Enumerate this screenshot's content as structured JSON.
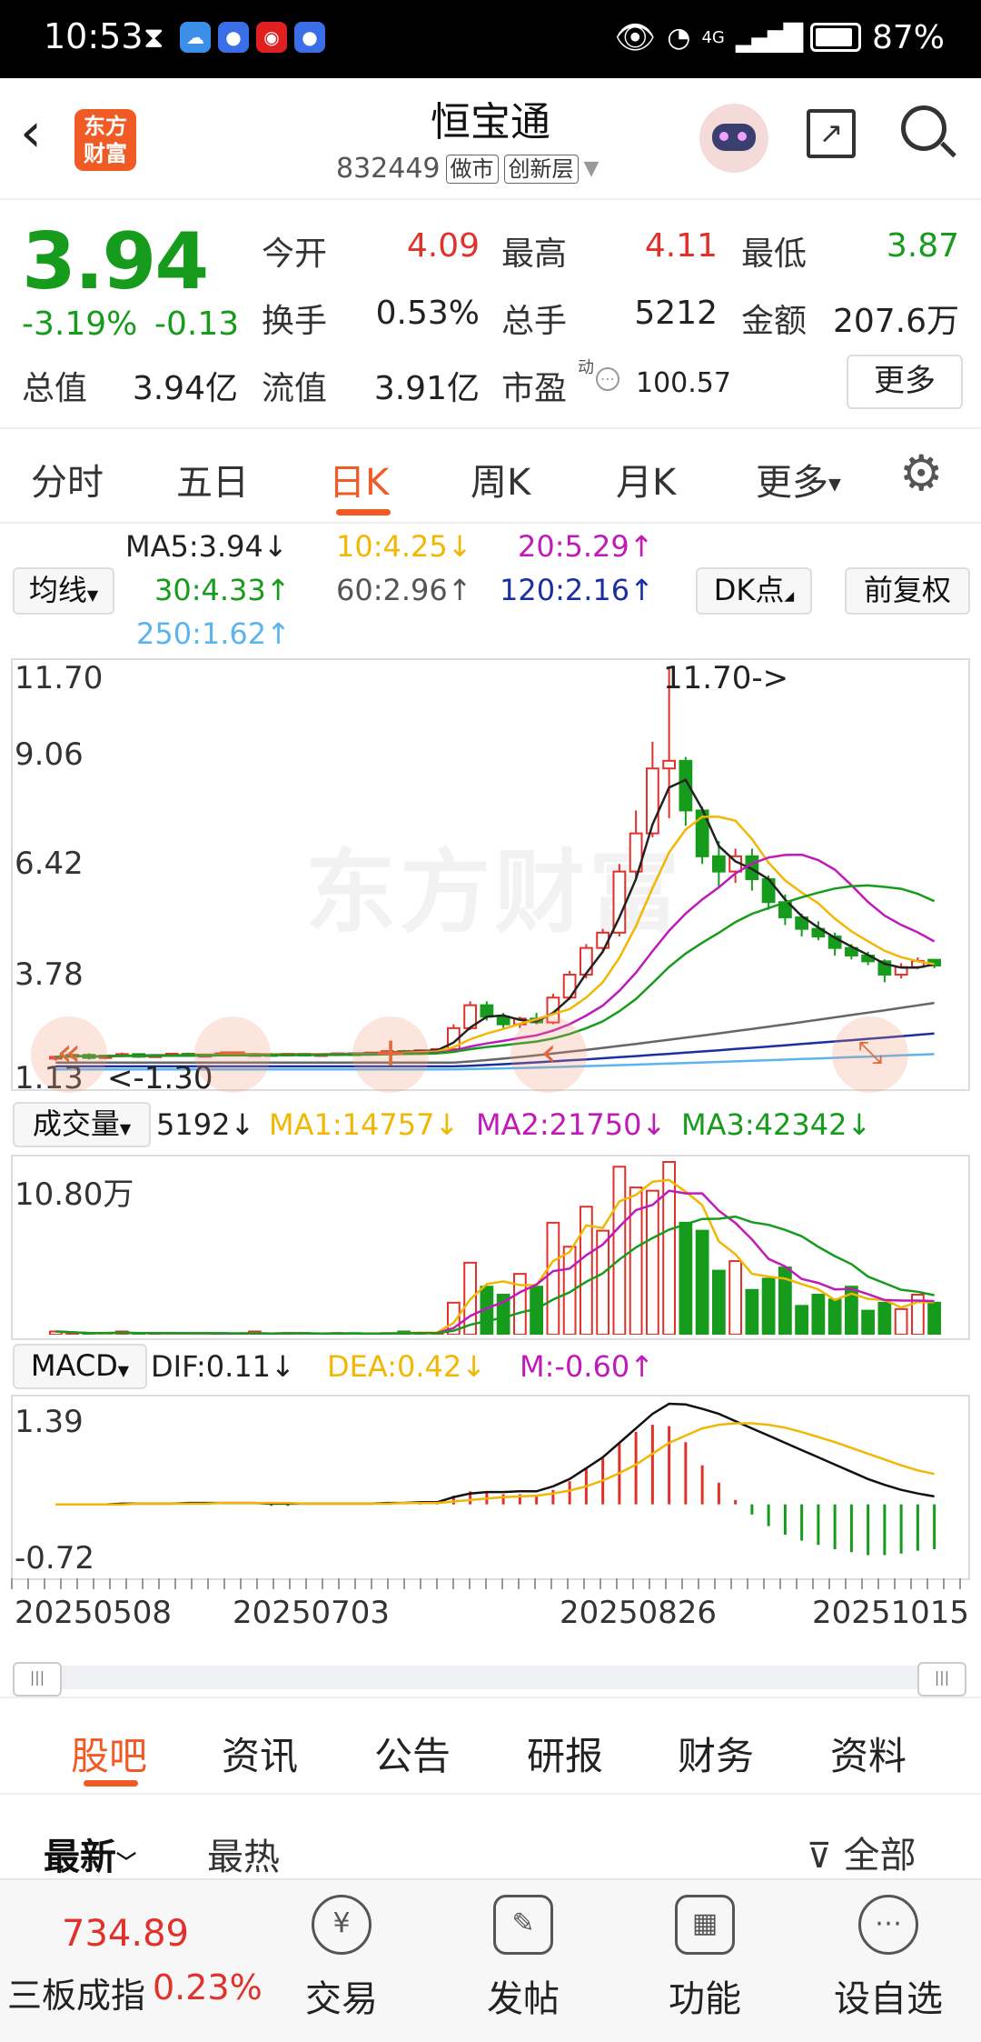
{
  "status_bar": {
    "time": "10:53",
    "network": "4G",
    "battery": "87%"
  },
  "header": {
    "title": "恒宝通",
    "code": "832449",
    "tags": [
      "做市",
      "创新层"
    ],
    "logo_text": "东方财富"
  },
  "quote": {
    "price": "3.94",
    "change_pct": "-3.19%",
    "change": "-0.13",
    "items": [
      {
        "label": "今开",
        "value": "4.09",
        "color": "#e0312b"
      },
      {
        "label": "最高",
        "value": "4.11",
        "color": "#e0312b"
      },
      {
        "label": "最低",
        "value": "3.87",
        "color": "#169b1c"
      },
      {
        "label": "换手",
        "value": "0.53%",
        "color": "#222222"
      },
      {
        "label": "总手",
        "value": "5212",
        "color": "#222222"
      },
      {
        "label": "金额",
        "value": "207.6万",
        "color": "#222222"
      },
      {
        "label": "总值",
        "value": "3.94亿",
        "color": "#222222"
      },
      {
        "label": "流值",
        "value": "3.91亿",
        "color": "#222222"
      },
      {
        "label": "市盈",
        "value": "100.57",
        "color": "#222222"
      }
    ],
    "pe_tag": "动",
    "more_label": "更多"
  },
  "kline_tabs": [
    "分时",
    "五日",
    "日K",
    "周K",
    "月K",
    "更多"
  ],
  "active_tab": "日K",
  "ma_legend": {
    "ma5": "MA5:3.94↓",
    "ma10": "10:4.25↓",
    "ma20": "20:5.29↑",
    "ma30": "30:4.33↑",
    "ma60": "60:2.96↑",
    "ma120": "120:2.16↑",
    "ma250": "250:1.62↑"
  },
  "ma_select": "均线",
  "dk_label": "DK点",
  "fuquan_label": "前复权",
  "chart_labels": {
    "price_ticks": [
      "11.70",
      "9.06",
      "6.42",
      "3.78",
      "1.13"
    ],
    "max_marker": "11.70->",
    "min_marker": "<-1.30",
    "watermark": "东方财富",
    "vol_select": "成交量",
    "vol_value": "5192↓",
    "vol_ma1": "MA1:14757↓",
    "vol_ma2": "MA2:21750↓",
    "vol_ma3": "MA3:42342↓",
    "vol_max": "10.80万",
    "macd_select": "MACD",
    "dif": "DIF:0.11↓",
    "dea": "DEA:0.42↓",
    "m": "M:-0.60↑",
    "macd_max": "1.39",
    "macd_min": "-0.72",
    "dates": [
      "20250508",
      "20250703",
      "20250826",
      "20251015"
    ]
  },
  "chart_data": {
    "type": "candlestick",
    "ylim": [
      1.13,
      11.7
    ],
    "dates": [
      "20250508",
      "20250703",
      "20250826",
      "20251015"
    ],
    "price_max": 11.7,
    "price_min": 1.3,
    "last_close": 3.94,
    "ma": {
      "MA5": 3.94,
      "MA10": 4.25,
      "MA20": 5.29,
      "MA30": 4.33,
      "MA60": 2.96,
      "MA120": 2.16,
      "MA250": 1.62
    },
    "candles": [
      {
        "o": 1.5,
        "c": 1.55,
        "h": 1.58,
        "l": 1.45
      },
      {
        "o": 1.55,
        "c": 1.6,
        "h": 1.62,
        "l": 1.5
      },
      {
        "o": 1.6,
        "c": 1.52,
        "h": 1.64,
        "l": 1.48
      },
      {
        "o": 1.52,
        "c": 1.58,
        "h": 1.6,
        "l": 1.49
      },
      {
        "o": 1.58,
        "c": 1.62,
        "h": 1.66,
        "l": 1.54
      },
      {
        "o": 1.62,
        "c": 1.55,
        "h": 1.64,
        "l": 1.52
      },
      {
        "o": 1.55,
        "c": 1.59,
        "h": 1.61,
        "l": 1.52
      },
      {
        "o": 1.59,
        "c": 1.63,
        "h": 1.65,
        "l": 1.56
      },
      {
        "o": 1.63,
        "c": 1.58,
        "h": 1.66,
        "l": 1.55
      },
      {
        "o": 1.58,
        "c": 1.6,
        "h": 1.62,
        "l": 1.55
      },
      {
        "o": 1.6,
        "c": 1.64,
        "h": 1.66,
        "l": 1.57
      },
      {
        "o": 1.64,
        "c": 1.6,
        "h": 1.66,
        "l": 1.57
      },
      {
        "o": 1.6,
        "c": 1.62,
        "h": 1.64,
        "l": 1.58
      },
      {
        "o": 1.62,
        "c": 1.61,
        "h": 1.65,
        "l": 1.58
      },
      {
        "o": 1.61,
        "c": 1.63,
        "h": 1.65,
        "l": 1.59
      },
      {
        "o": 1.63,
        "c": 1.6,
        "h": 1.64,
        "l": 1.58
      },
      {
        "o": 1.6,
        "c": 1.62,
        "h": 1.63,
        "l": 1.58
      },
      {
        "o": 1.62,
        "c": 1.64,
        "h": 1.66,
        "l": 1.6
      },
      {
        "o": 1.64,
        "c": 1.63,
        "h": 1.66,
        "l": 1.61
      },
      {
        "o": 1.63,
        "c": 1.66,
        "h": 1.68,
        "l": 1.61
      },
      {
        "o": 1.66,
        "c": 1.7,
        "h": 1.72,
        "l": 1.64
      },
      {
        "o": 1.7,
        "c": 1.68,
        "h": 1.73,
        "l": 1.66
      },
      {
        "o": 1.68,
        "c": 1.72,
        "h": 1.74,
        "l": 1.66
      },
      {
        "o": 1.72,
        "c": 1.75,
        "h": 1.78,
        "l": 1.7
      },
      {
        "o": 1.75,
        "c": 2.3,
        "h": 2.4,
        "l": 1.74
      },
      {
        "o": 2.3,
        "c": 2.9,
        "h": 3.0,
        "l": 2.25
      },
      {
        "o": 2.9,
        "c": 2.6,
        "h": 3.0,
        "l": 2.5
      },
      {
        "o": 2.6,
        "c": 2.4,
        "h": 2.7,
        "l": 2.3
      },
      {
        "o": 2.4,
        "c": 2.55,
        "h": 2.6,
        "l": 2.3
      },
      {
        "o": 2.55,
        "c": 2.45,
        "h": 2.7,
        "l": 2.4
      },
      {
        "o": 2.45,
        "c": 3.1,
        "h": 3.2,
        "l": 2.4
      },
      {
        "o": 3.1,
        "c": 3.7,
        "h": 3.8,
        "l": 3.05
      },
      {
        "o": 3.7,
        "c": 4.4,
        "h": 4.5,
        "l": 3.6
      },
      {
        "o": 4.4,
        "c": 4.8,
        "h": 4.9,
        "l": 4.3
      },
      {
        "o": 4.8,
        "c": 6.4,
        "h": 6.6,
        "l": 4.7
      },
      {
        "o": 6.4,
        "c": 7.4,
        "h": 8.0,
        "l": 6.2
      },
      {
        "o": 7.4,
        "c": 9.1,
        "h": 9.8,
        "l": 7.3
      },
      {
        "o": 9.1,
        "c": 9.3,
        "h": 11.7,
        "l": 7.8
      },
      {
        "o": 9.3,
        "c": 8.0,
        "h": 9.4,
        "l": 7.6
      },
      {
        "o": 8.0,
        "c": 6.8,
        "h": 8.1,
        "l": 6.6
      },
      {
        "o": 6.8,
        "c": 6.4,
        "h": 7.2,
        "l": 6.0
      },
      {
        "o": 6.4,
        "c": 6.8,
        "h": 7.0,
        "l": 6.1
      },
      {
        "o": 6.8,
        "c": 6.2,
        "h": 7.0,
        "l": 5.9
      },
      {
        "o": 6.2,
        "c": 5.6,
        "h": 6.3,
        "l": 5.4
      },
      {
        "o": 5.6,
        "c": 5.2,
        "h": 5.8,
        "l": 5.0
      },
      {
        "o": 5.2,
        "c": 4.9,
        "h": 5.3,
        "l": 4.7
      },
      {
        "o": 4.9,
        "c": 4.7,
        "h": 5.1,
        "l": 4.6
      },
      {
        "o": 4.7,
        "c": 4.4,
        "h": 4.8,
        "l": 4.2
      },
      {
        "o": 4.4,
        "c": 4.2,
        "h": 4.5,
        "l": 4.1
      },
      {
        "o": 4.2,
        "c": 4.05,
        "h": 4.3,
        "l": 3.95
      },
      {
        "o": 4.05,
        "c": 3.7,
        "h": 4.1,
        "l": 3.5
      },
      {
        "o": 3.7,
        "c": 3.9,
        "h": 4.0,
        "l": 3.6
      },
      {
        "o": 3.9,
        "c": 4.06,
        "h": 4.15,
        "l": 3.85
      },
      {
        "o": 4.09,
        "c": 3.94,
        "h": 4.11,
        "l": 3.87
      }
    ],
    "volume_max": 108000,
    "volumes": [
      2,
      1,
      0,
      1,
      2,
      0,
      1,
      1,
      0,
      1,
      1,
      0,
      2,
      0,
      1,
      1,
      0,
      1,
      1,
      0,
      1,
      2,
      1,
      1,
      20,
      45,
      30,
      25,
      38,
      30,
      70,
      55,
      80,
      65,
      105,
      92,
      90,
      108,
      70,
      65,
      40,
      46,
      28,
      35,
      42,
      18,
      25,
      22,
      30,
      15,
      20,
      16,
      25,
      20
    ],
    "macd_ylim": [
      -0.72,
      1.39
    ],
    "dif": [
      0.0,
      0.0,
      0.0,
      0.0,
      0.01,
      0.01,
      0.01,
      0.01,
      0.02,
      0.02,
      0.02,
      0.02,
      0.02,
      0.01,
      0.01,
      0.01,
      0.01,
      0.01,
      0.01,
      0.01,
      0.02,
      0.02,
      0.03,
      0.03,
      0.1,
      0.15,
      0.17,
      0.17,
      0.18,
      0.18,
      0.25,
      0.35,
      0.5,
      0.65,
      0.85,
      1.05,
      1.25,
      1.39,
      1.38,
      1.32,
      1.25,
      1.15,
      1.05,
      0.95,
      0.85,
      0.75,
      0.65,
      0.55,
      0.45,
      0.35,
      0.27,
      0.2,
      0.15,
      0.11
    ],
    "dea": [
      0.0,
      0.0,
      0.0,
      0.0,
      0.0,
      0.01,
      0.01,
      0.01,
      0.01,
      0.01,
      0.02,
      0.02,
      0.02,
      0.02,
      0.02,
      0.01,
      0.01,
      0.01,
      0.01,
      0.01,
      0.01,
      0.02,
      0.02,
      0.02,
      0.04,
      0.06,
      0.08,
      0.1,
      0.11,
      0.12,
      0.15,
      0.19,
      0.25,
      0.33,
      0.43,
      0.55,
      0.7,
      0.85,
      0.95,
      1.05,
      1.1,
      1.12,
      1.12,
      1.1,
      1.06,
      1.0,
      0.93,
      0.86,
      0.78,
      0.7,
      0.62,
      0.54,
      0.47,
      0.42
    ]
  },
  "bottom_tabs": [
    "股吧",
    "资讯",
    "公告",
    "研报",
    "财务",
    "资料"
  ],
  "feed_sort": {
    "latest": "最新",
    "hot": "最热",
    "filter": "全部"
  },
  "footer": {
    "index_value": "734.89",
    "index_name": "三板成指",
    "index_change": "0.23%",
    "actions": [
      {
        "label": "交易",
        "icon": "yen-exchange-icon",
        "glyph": "¥"
      },
      {
        "label": "发帖",
        "icon": "edit-post-icon",
        "glyph": "✎"
      },
      {
        "label": "功能",
        "icon": "grid-icon",
        "glyph": "▦"
      },
      {
        "label": "设自选",
        "icon": "more-circle-icon",
        "glyph": "⋯"
      }
    ]
  }
}
